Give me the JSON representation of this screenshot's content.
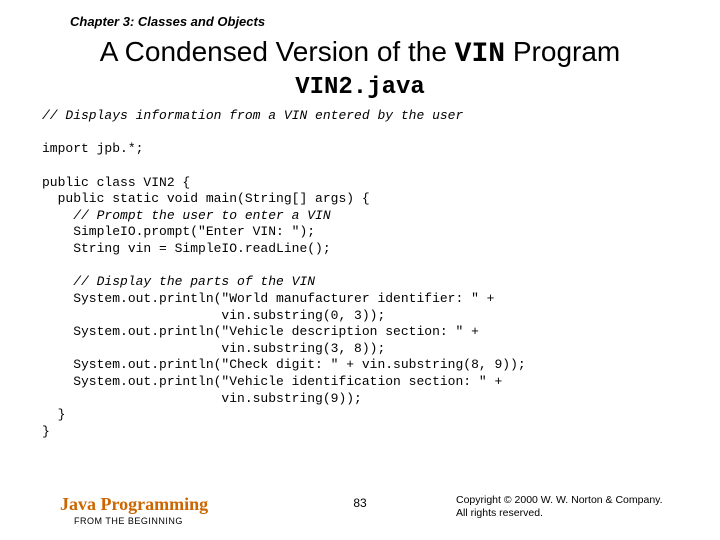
{
  "chapter": "Chapter 3: Classes and Objects",
  "title_prefix": "A Condensed Version of the ",
  "title_mono": "VIN",
  "title_suffix": " Program",
  "subtitle": "VIN2.java",
  "code": {
    "c1": "// Displays information from a VIN entered by the user",
    "l2": "import jpb.*;",
    "l3": "public class VIN2 {",
    "l4": "  public static void main(String[] args) {",
    "c5": "    // Prompt the user to enter a VIN",
    "l6": "    SimpleIO.prompt(\"Enter VIN: \");",
    "l7": "    String vin = SimpleIO.readLine();",
    "c8": "    // Display the parts of the VIN",
    "l9": "    System.out.println(\"World manufacturer identifier: \" +",
    "l10": "                       vin.substring(0, 3));",
    "l11": "    System.out.println(\"Vehicle description section: \" +",
    "l12": "                       vin.substring(3, 8));",
    "l13": "    System.out.println(\"Check digit: \" + vin.substring(8, 9));",
    "l14": "    System.out.println(\"Vehicle identification section: \" +",
    "l15": "                       vin.substring(9));",
    "l16": "  }",
    "l17": "}"
  },
  "footer": {
    "brand": "Java Programming",
    "tagline": "FROM THE BEGINNING",
    "page": "83",
    "copyright1": "Copyright © 2000 W. W. Norton & Company.",
    "copyright2": "All rights reserved."
  }
}
